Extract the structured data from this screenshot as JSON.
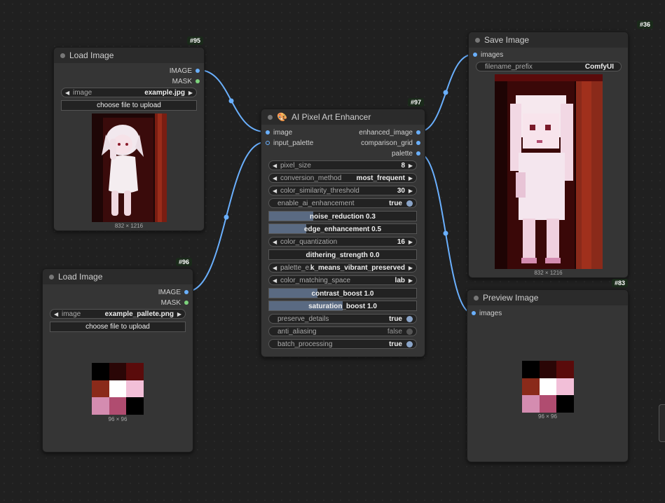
{
  "load_image_1": {
    "id": "#95",
    "title": "Load Image",
    "outputs": [
      "IMAGE",
      "MASK"
    ],
    "image_label": "image",
    "image_value": "example.jpg",
    "upload_label": "choose file to upload",
    "caption": "832 × 1216"
  },
  "load_image_2": {
    "id": "#96",
    "title": "Load Image",
    "outputs": [
      "IMAGE",
      "MASK"
    ],
    "image_label": "image",
    "image_value": "example_pallete.png",
    "upload_label": "choose file to upload",
    "caption": "96 × 96"
  },
  "enhancer": {
    "id": "#97",
    "title": "AI Pixel Art Enhancer",
    "inputs": [
      "image",
      "input_palette"
    ],
    "outputs": [
      "enhanced_image",
      "comparison_grid",
      "palette"
    ],
    "pixel_size": {
      "label": "pixel_size",
      "value": "8"
    },
    "conversion_method": {
      "label": "conversion_method",
      "value": "most_frequent"
    },
    "color_similarity_threshold": {
      "label": "color_similarity_threshold",
      "value": "30"
    },
    "enable_ai_enhancement": {
      "label": "enable_ai_enhancement",
      "value": "true"
    },
    "noise_reduction": {
      "text": "noise_reduction  0.3",
      "level": 0.3
    },
    "edge_enhancement": {
      "text": "edge_enhancement  0.5",
      "level": 0.25
    },
    "color_quantization": {
      "label": "color_quantization",
      "value": "16"
    },
    "dithering_strength": {
      "text": "dithering_strength  0.0",
      "level": 0.0
    },
    "palette_extraction": {
      "label": "palette_e...",
      "value": "k_means_vibrant_preserved"
    },
    "color_matching_space": {
      "label": "color_matching_space",
      "value": "lab"
    },
    "contrast_boost": {
      "text": "contrast_boost  1.0",
      "level": 0.33
    },
    "saturation_boost": {
      "text": "saturation_boost  1.0",
      "level": 0.5
    },
    "preserve_details": {
      "label": "preserve_details",
      "value": "true"
    },
    "anti_aliasing": {
      "label": "anti_aliasing",
      "value": "false"
    },
    "batch_processing": {
      "label": "batch_processing",
      "value": "true"
    }
  },
  "save_image": {
    "id": "#36",
    "title": "Save Image",
    "input": "images",
    "filename_prefix_label": "filename_prefix",
    "filename_prefix_value": "ComfyUI",
    "caption": "832 × 1216"
  },
  "preview_image": {
    "id": "#83",
    "title": "Preview Image",
    "input": "images",
    "caption": "96 × 96"
  },
  "palette_colors": [
    "#000000",
    "#2a0606",
    "#5a0b0b",
    "#8a2a1a",
    "#ffffff",
    "#f2bfd8",
    "#d48cb0",
    "#b04c70",
    "#000000"
  ],
  "colors": {
    "link": "#6ab0ff",
    "node_bg": "#353535",
    "title_bg": "#2b2b2b",
    "canvas": "#202020",
    "slider_fill": "#5a6a82"
  }
}
